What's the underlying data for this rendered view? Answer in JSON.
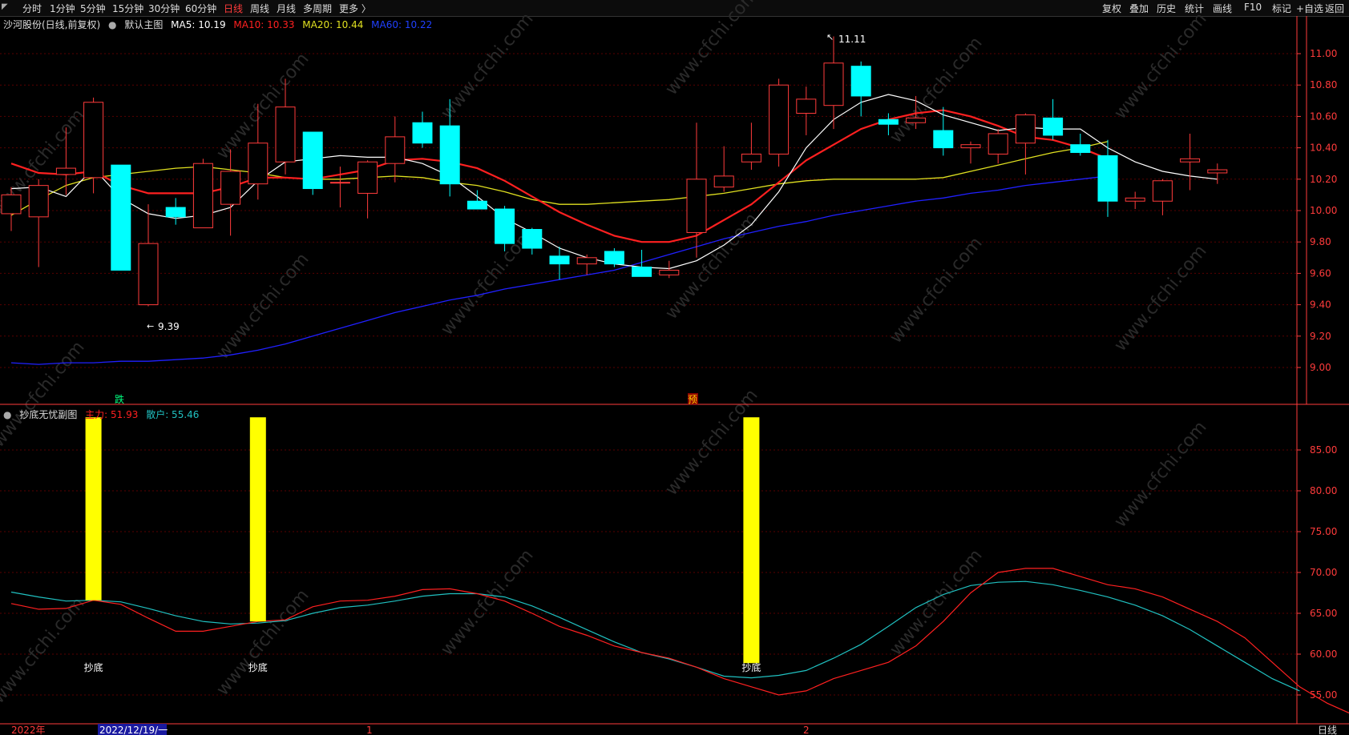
{
  "toolbar": {
    "left": [
      "分时",
      "1分钟",
      "5分钟",
      "15分钟",
      "30分钟",
      "60分钟",
      "日线",
      "周线",
      "月线",
      "多周期",
      "更多 〉"
    ],
    "active": "日线",
    "right": [
      "复权",
      "叠加",
      "历史",
      "统计",
      "画线",
      "F10",
      "标记",
      "+自选",
      "返回"
    ]
  },
  "main_info": {
    "stock": "沙河股份(日线,前复权)",
    "indicator": "默认主图",
    "ma5": "MA5: 10.19",
    "ma10": "MA10: 10.33",
    "ma20": "MA20: 10.44",
    "ma60": "MA60: 10.22"
  },
  "sub_info": {
    "name": "抄底无忧副图",
    "main_force": "主力: 51.93",
    "retail": "散户: 55.46"
  },
  "annotations": {
    "high_label": "11.11",
    "low_label": "9.39",
    "die_tag": "跌",
    "yu_tag": "预",
    "chaodi": "抄底"
  },
  "bottom_bar": {
    "year": "2022年",
    "date": "2022/12/19/一",
    "month1": "1",
    "month2": "2",
    "period": "日线"
  },
  "colors": {
    "up": "#ff3b3b",
    "down": "#00ffff",
    "ma5": "#ffffff",
    "ma10": "#ff2020",
    "ma20": "#e0e020",
    "ma60": "#2020ff",
    "main_force": "#ff2020",
    "retail": "#20c0c0",
    "signal_bar": "#ffff00"
  },
  "chart_data": [
    {
      "type": "candlestick",
      "title": "",
      "ylim": [
        8.94,
        11.24
      ],
      "yticks": [
        "11.00",
        "10.80",
        "10.60",
        "10.40",
        "10.20",
        "10.00",
        "9.80",
        "9.60",
        "9.40",
        "9.20",
        "9.00"
      ],
      "candles": [
        {
          "o": 9.98,
          "h": 10.15,
          "l": 9.87,
          "c": 10.1
        },
        {
          "o": 9.96,
          "h": 10.2,
          "l": 9.64,
          "c": 10.16
        },
        {
          "o": 10.23,
          "h": 10.53,
          "l": 10.1,
          "c": 10.27
        },
        {
          "o": 10.21,
          "h": 10.72,
          "l": 10.11,
          "c": 10.69
        },
        {
          "o": 10.29,
          "h": 10.29,
          "l": 9.62,
          "c": 9.62
        },
        {
          "o": 9.4,
          "h": 10.04,
          "l": 9.39,
          "c": 9.79
        },
        {
          "o": 10.02,
          "h": 10.08,
          "l": 9.91,
          "c": 9.96
        },
        {
          "o": 9.89,
          "h": 10.33,
          "l": 9.89,
          "c": 10.3
        },
        {
          "o": 10.04,
          "h": 10.39,
          "l": 9.84,
          "c": 10.25
        },
        {
          "o": 10.17,
          "h": 10.68,
          "l": 10.07,
          "c": 10.43
        },
        {
          "o": 10.31,
          "h": 10.84,
          "l": 10.23,
          "c": 10.66
        },
        {
          "o": 10.5,
          "h": 10.5,
          "l": 10.1,
          "c": 10.14
        },
        {
          "o": 10.18,
          "h": 10.28,
          "l": 10.02,
          "c": 10.18
        },
        {
          "o": 10.11,
          "h": 10.32,
          "l": 9.95,
          "c": 10.31
        },
        {
          "o": 10.3,
          "h": 10.6,
          "l": 10.18,
          "c": 10.47
        },
        {
          "o": 10.56,
          "h": 10.63,
          "l": 10.4,
          "c": 10.43
        },
        {
          "o": 10.54,
          "h": 10.71,
          "l": 10.09,
          "c": 10.17
        },
        {
          "o": 10.06,
          "h": 10.13,
          "l": 10.01,
          "c": 10.01
        },
        {
          "o": 10.01,
          "h": 10.03,
          "l": 9.74,
          "c": 9.79
        },
        {
          "o": 9.88,
          "h": 9.89,
          "l": 9.72,
          "c": 9.76
        },
        {
          "o": 9.71,
          "h": 9.77,
          "l": 9.56,
          "c": 9.66
        },
        {
          "o": 9.66,
          "h": 9.72,
          "l": 9.59,
          "c": 9.7
        },
        {
          "o": 9.74,
          "h": 9.76,
          "l": 9.64,
          "c": 9.66
        },
        {
          "o": 9.64,
          "h": 9.75,
          "l": 9.58,
          "c": 9.58
        },
        {
          "o": 9.59,
          "h": 9.68,
          "l": 9.57,
          "c": 9.62
        },
        {
          "o": 9.86,
          "h": 10.56,
          "l": 9.7,
          "c": 10.2
        },
        {
          "o": 10.15,
          "h": 10.41,
          "l": 10.12,
          "c": 10.22
        },
        {
          "o": 10.31,
          "h": 10.56,
          "l": 10.26,
          "c": 10.36
        },
        {
          "o": 10.36,
          "h": 10.84,
          "l": 10.28,
          "c": 10.8
        },
        {
          "o": 10.62,
          "h": 10.79,
          "l": 10.48,
          "c": 10.71
        },
        {
          "o": 10.67,
          "h": 11.11,
          "l": 10.52,
          "c": 10.94
        },
        {
          "o": 10.92,
          "h": 10.95,
          "l": 10.6,
          "c": 10.73
        },
        {
          "o": 10.58,
          "h": 10.62,
          "l": 10.48,
          "c": 10.55
        },
        {
          "o": 10.56,
          "h": 10.73,
          "l": 10.52,
          "c": 10.59
        },
        {
          "o": 10.51,
          "h": 10.66,
          "l": 10.35,
          "c": 10.4
        },
        {
          "o": 10.4,
          "h": 10.44,
          "l": 10.3,
          "c": 10.42
        },
        {
          "o": 10.36,
          "h": 10.52,
          "l": 10.3,
          "c": 10.49
        },
        {
          "o": 10.43,
          "h": 10.62,
          "l": 10.23,
          "c": 10.61
        },
        {
          "o": 10.59,
          "h": 10.71,
          "l": 10.45,
          "c": 10.48
        },
        {
          "o": 10.42,
          "h": 10.49,
          "l": 10.35,
          "c": 10.37
        },
        {
          "o": 10.35,
          "h": 10.45,
          "l": 9.96,
          "c": 10.06
        },
        {
          "o": 10.06,
          "h": 10.12,
          "l": 10.01,
          "c": 10.08
        },
        {
          "o": 10.06,
          "h": 10.2,
          "l": 9.97,
          "c": 10.19
        },
        {
          "o": 10.31,
          "h": 10.49,
          "l": 10.13,
          "c": 10.33
        },
        {
          "o": 10.24,
          "h": 10.3,
          "l": 10.17,
          "c": 10.26
        }
      ],
      "ma5": [
        10.14,
        10.15,
        10.09,
        10.27,
        10.08,
        9.98,
        9.95,
        9.97,
        10.02,
        10.19,
        10.31,
        10.33,
        10.35,
        10.34,
        10.34,
        10.3,
        10.22,
        10.09,
        9.95,
        9.86,
        9.76,
        9.7,
        9.66,
        9.64,
        9.63,
        9.68,
        9.78,
        9.91,
        10.12,
        10.4,
        10.58,
        10.69,
        10.74,
        10.7,
        10.61,
        10.56,
        10.51,
        10.53,
        10.52,
        10.52,
        10.4,
        10.31,
        10.25,
        10.22,
        10.2
      ],
      "ma10": [
        10.3,
        10.24,
        10.23,
        10.25,
        10.16,
        10.11,
        10.11,
        10.11,
        10.15,
        10.21,
        10.21,
        10.2,
        10.23,
        10.26,
        10.32,
        10.33,
        10.31,
        10.27,
        10.19,
        10.09,
        9.99,
        9.91,
        9.84,
        9.8,
        9.8,
        9.84,
        9.94,
        10.04,
        10.18,
        10.32,
        10.42,
        10.52,
        10.58,
        10.62,
        10.64,
        10.6,
        10.54,
        10.47,
        10.45,
        10.4,
        10.33
      ],
      "ma20": [
        9.97,
        10.07,
        10.16,
        10.21,
        10.23,
        10.25,
        10.27,
        10.28,
        10.26,
        10.24,
        10.21,
        10.2,
        10.2,
        10.21,
        10.22,
        10.21,
        10.18,
        10.16,
        10.12,
        10.07,
        10.04,
        10.04,
        10.05,
        10.06,
        10.07,
        10.09,
        10.11,
        10.14,
        10.17,
        10.19,
        10.2,
        10.2,
        10.2,
        10.2,
        10.21,
        10.25,
        10.29,
        10.33,
        10.37,
        10.4,
        10.44
      ],
      "ma60": [
        9.03,
        9.02,
        9.03,
        9.03,
        9.04,
        9.04,
        9.05,
        9.06,
        9.08,
        9.11,
        9.15,
        9.2,
        9.25,
        9.3,
        9.35,
        9.39,
        9.43,
        9.46,
        9.5,
        9.53,
        9.56,
        9.59,
        9.62,
        9.67,
        9.72,
        9.77,
        9.82,
        9.86,
        9.9,
        9.93,
        9.97,
        10.0,
        10.03,
        10.06,
        10.08,
        10.11,
        10.13,
        10.16,
        10.18,
        10.2,
        10.22
      ]
    },
    {
      "type": "line",
      "title": "抄底无忧副图",
      "ylim": [
        51,
        90
      ],
      "yticks": [
        "85.00",
        "80.00",
        "75.00",
        "70.00",
        "65.00",
        "60.00",
        "55.00"
      ],
      "series": [
        {
          "name": "主力",
          "values": [
            66.2,
            65.5,
            65.6,
            66.6,
            66.1,
            64.4,
            62.8,
            62.8,
            63.4,
            64.0,
            64.2,
            65.8,
            66.5,
            66.6,
            67.1,
            67.9,
            68.0,
            67.4,
            66.5,
            65.0,
            63.4,
            62.3,
            61.0,
            60.2,
            59.5,
            58.4,
            57.0,
            56.0,
            55.0,
            55.5,
            57.0,
            58.0,
            59.0,
            61.0,
            64.0,
            67.5,
            70.0,
            70.5,
            70.5,
            69.5,
            68.5,
            68.0,
            67.0,
            65.5,
            64.0,
            62.0,
            59.0,
            56.0,
            54.0,
            52.5,
            51.9
          ]
        },
        {
          "name": "散户",
          "values": [
            67.6,
            67.0,
            66.5,
            66.6,
            66.4,
            65.6,
            64.7,
            64.0,
            63.7,
            63.8,
            64.1,
            65.0,
            65.7,
            66.0,
            66.5,
            67.1,
            67.4,
            67.4,
            67.0,
            65.9,
            64.5,
            63.0,
            61.5,
            60.2,
            59.4,
            58.4,
            57.3,
            57.1,
            57.4,
            58.0,
            59.5,
            61.2,
            63.4,
            65.7,
            67.3,
            68.4,
            68.8,
            68.9,
            68.5,
            67.8,
            67.0,
            66.0,
            64.7,
            63.0,
            61.0,
            59.0,
            57.0,
            55.5
          ]
        }
      ],
      "signals": [
        {
          "bar": 3,
          "value": 66.6
        },
        {
          "bar": 9,
          "value": 64.0
        },
        {
          "bar": 27,
          "value": 58.9
        }
      ]
    }
  ]
}
